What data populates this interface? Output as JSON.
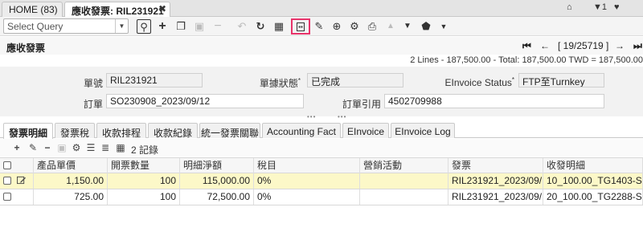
{
  "window_tabs": {
    "home": "HOME (83)",
    "active": "應收發票: RIL231921",
    "close": "✖"
  },
  "top_right": {
    "home_icon": "⌂",
    "menu": "▼1",
    "heart": "♥"
  },
  "toolbar": {
    "query_placeholder": "Select Query"
  },
  "header": {
    "title": "應收發票",
    "record_nav": "[ 19/25719 ]",
    "summary": "2 Lines - 187,500.00 - Total: 187,500.00 TWD = 187,500.00"
  },
  "form": {
    "doc_no_label": "單號",
    "doc_no": "RIL231921",
    "doc_status_label": "單據狀態",
    "doc_status": "已完成",
    "einvoice_status_label": "EInvoice Status",
    "einvoice_status": "FTP至Turnkey",
    "order_label": "訂單",
    "order": "SO230908_2023/09/12",
    "order_ref_label": "訂單引用",
    "order_ref": "4502709988",
    "required_mark": "*"
  },
  "detail_tabs": [
    "發票明細",
    "發票稅",
    "收款排程",
    "收款紀錄",
    "統一發票關聯",
    "Accounting Fact",
    "EInvoice",
    "EInvoice Log"
  ],
  "detail_toolbar": {
    "count": "2 記錄"
  },
  "grid": {
    "headers": [
      "產品單價",
      "開票數量",
      "明細淨額",
      "稅目",
      "營銷活動",
      "發票",
      "收發明細"
    ],
    "rows": [
      {
        "price": "1,150.00",
        "qty": "100",
        "net": "115,000.00",
        "tax": "0%",
        "campaign": "",
        "invoice": "RIL231921_2023/09/...",
        "receipt": "10_100.00_TG1403-S..."
      },
      {
        "price": "725.00",
        "qty": "100",
        "net": "72,500.00",
        "tax": "0%",
        "campaign": "",
        "invoice": "RIL231921_2023/09/...",
        "receipt": "20_100.00_TG2288-S..."
      }
    ]
  },
  "colors": {
    "highlight_border": "#e8336a",
    "selected_row": "#fcf8c8"
  }
}
